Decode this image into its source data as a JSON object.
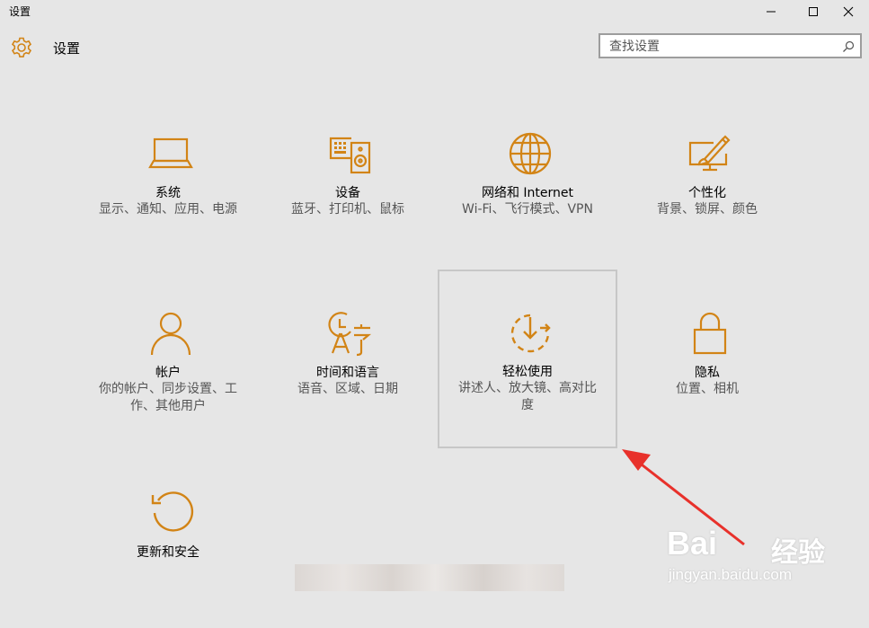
{
  "window": {
    "title": "设置",
    "accent_color": "#d28416",
    "controls": [
      "minimize-icon",
      "maximize-icon",
      "close-icon"
    ]
  },
  "header": {
    "icon": "gear-icon",
    "title": "设置",
    "search": {
      "placeholder": "查找设置",
      "icon": "search-icon"
    }
  },
  "tiles": [
    {
      "icon": "laptop-icon",
      "name": "系统",
      "desc": "显示、通知、应用、电源"
    },
    {
      "icon": "devices-icon",
      "name": "设备",
      "desc": "蓝牙、打印机、鼠标"
    },
    {
      "icon": "globe-icon",
      "name": "网络和 Internet",
      "desc": "Wi-Fi、飞行模式、VPN"
    },
    {
      "icon": "personalization-icon",
      "name": "个性化",
      "desc": "背景、锁屏、颜色"
    },
    {
      "icon": "person-icon",
      "name": "帐户",
      "desc": "你的帐户、同步设置、工作、其他用户"
    },
    {
      "icon": "time-language-icon",
      "name": "时间和语言",
      "desc": "语音、区域、日期"
    },
    {
      "icon": "ease-of-access-icon",
      "name": "轻松使用",
      "desc": "讲述人、放大镜、高对比度",
      "selected": true
    },
    {
      "icon": "lock-icon",
      "name": "隐私",
      "desc": "位置、相机"
    },
    {
      "icon": "refresh-icon",
      "name": "更新和安全",
      "desc": ""
    }
  ],
  "annotation": {
    "color": "#e8312b"
  },
  "watermark": {
    "brand": "Bai",
    "sub": "经验",
    "url": "jingyan.baidu.com"
  }
}
